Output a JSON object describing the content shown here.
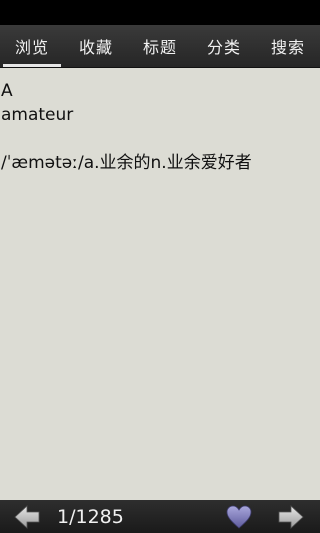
{
  "tabs": [
    {
      "label": "浏览",
      "active": true
    },
    {
      "label": "收藏",
      "active": false
    },
    {
      "label": "标题",
      "active": false
    },
    {
      "label": "分类",
      "active": false
    },
    {
      "label": "搜索",
      "active": false
    }
  ],
  "entry": {
    "letter": "A",
    "word": "amateur",
    "definition": "/ˈæmətəː/a.业余的n.业余爱好者"
  },
  "pager": {
    "counter": "1/1285"
  },
  "icons": {
    "prev": "left-arrow-icon",
    "next": "right-arrow-icon",
    "favorite": "heart-icon"
  },
  "colors": {
    "background": "#dcdcd4",
    "bar": "#2a2a2a",
    "heart": "#7a78b8"
  }
}
